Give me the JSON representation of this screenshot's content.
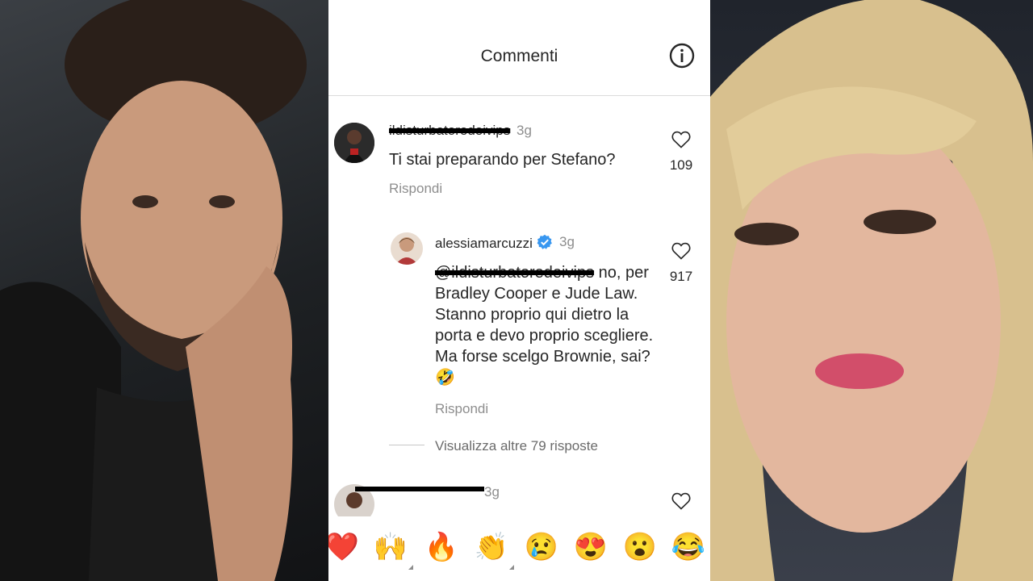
{
  "header": {
    "title": "Commenti"
  },
  "comments": [
    {
      "username": "ildisturbatoredeivips",
      "time": "3g",
      "text": "Ti stai preparando per Stefano?",
      "reply_label": "Rispondi",
      "likes": "109"
    }
  ],
  "reply": {
    "username": "alessiamarcuzzi",
    "time": "3g",
    "mention": "@ildisturbatoredeivips",
    "text_line1_tail": " no, per",
    "text_lines": [
      "Bradley Cooper e Jude Law.",
      "Stanno proprio qui dietro la",
      "porta e devo proprio scegliere.",
      "Ma forse scelgo Brownie, sai?"
    ],
    "emoji": "🤣",
    "reply_label": "Rispondi",
    "likes": "917"
  },
  "more_replies": "Visualizza altre 79 risposte",
  "third_comment": {
    "time": "3g"
  },
  "emoji_bar": [
    "❤️",
    "🙌",
    "🔥",
    "👏",
    "😢",
    "😍",
    "😮",
    "😂"
  ],
  "colors": {
    "text": "#262626",
    "secondary": "#8e8e8e",
    "verified": "#3897f0"
  }
}
